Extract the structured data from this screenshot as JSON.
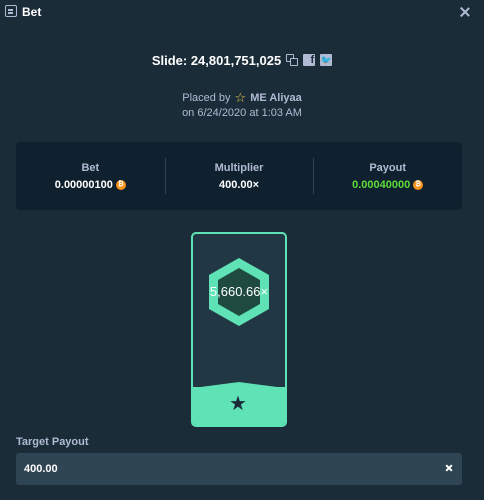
{
  "header": {
    "title": "Bet"
  },
  "slide": {
    "label": "Slide: 24,801,751,025"
  },
  "placed": {
    "prefix": "Placed by",
    "user": "ME Aliyaa",
    "date": "on 6/24/2020 at 1:03 AM"
  },
  "stats": {
    "bet_label": "Bet",
    "bet_value": "0.00000100",
    "multiplier_label": "Multiplier",
    "multiplier_value": "400.00×",
    "payout_label": "Payout",
    "payout_value": "0.00040000"
  },
  "card": {
    "multiplier": "5,660.66×"
  },
  "target": {
    "label": "Target Payout",
    "value": "400.00"
  },
  "colors": {
    "background": "#1a2c38",
    "panel": "#0f212e",
    "accent_green": "#5ddd3c",
    "card_accent": "#5fe3b6",
    "coin": "#f7931a"
  },
  "icons": {
    "header": "bet-slip-icon",
    "close": "close-icon",
    "copy": "copy-icon",
    "facebook": "facebook-icon",
    "twitter": "twitter-icon",
    "star": "star-outline-icon",
    "coin": "bitcoin-icon",
    "card_star": "star-icon",
    "clear": "clear-icon"
  }
}
